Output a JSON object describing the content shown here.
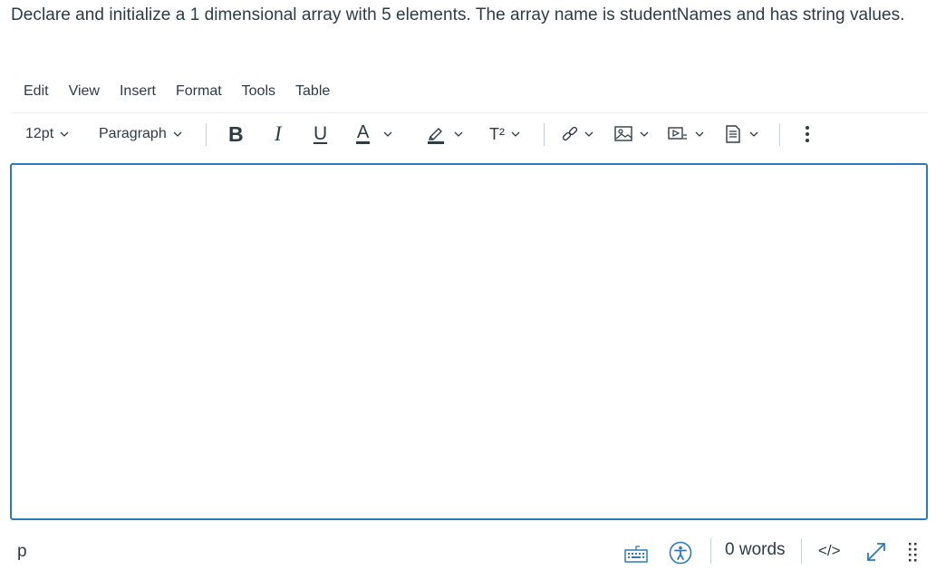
{
  "question": "Declare and initialize a 1 dimensional array with 5 elements.  The array name is studentNames and has string values.",
  "menubar": {
    "items": [
      {
        "label": "Edit"
      },
      {
        "label": "View"
      },
      {
        "label": "Insert"
      },
      {
        "label": "Format"
      },
      {
        "label": "Tools"
      },
      {
        "label": "Table"
      }
    ]
  },
  "toolbar": {
    "font_size": "12pt",
    "block_format": "Paragraph",
    "bold_label": "B",
    "italic_label": "I",
    "underline_label": "U",
    "text_color_label": "A",
    "superscript_label": "T²",
    "icons": [
      "bold-icon",
      "italic-icon",
      "underline-icon",
      "text-color-icon",
      "highlight-icon",
      "superscript-icon",
      "link-icon",
      "image-icon",
      "media-icon",
      "document-icon",
      "more-options-icon"
    ]
  },
  "editor": {
    "content": ""
  },
  "statusbar": {
    "path": "p",
    "word_count": "0 words",
    "code_view_label": "</>",
    "icons": [
      "keyboard-icon",
      "accessibility-icon",
      "fullscreen-icon",
      "resize-handle-icon"
    ]
  },
  "colors": {
    "accent": "#2b7abc",
    "text": "#2d3b45",
    "separator": "#c7cdd1"
  }
}
